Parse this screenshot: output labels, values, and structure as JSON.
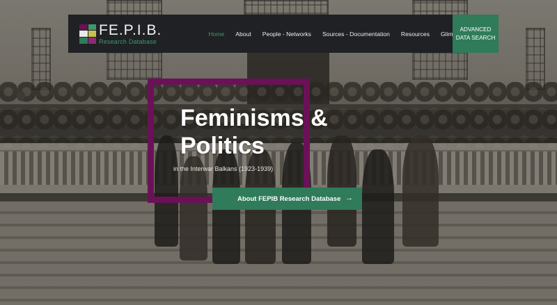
{
  "brand": {
    "title": "FE.P.I.B.",
    "subtitle": "Research Database",
    "logo_colors": [
      "#6b1157",
      "#3c9a6e",
      "#c9c24a",
      "#e8e8e8",
      "#2f7b5a",
      "#8d2a76"
    ]
  },
  "nav": {
    "items": [
      {
        "label": "Home",
        "active": true
      },
      {
        "label": "About",
        "active": false
      },
      {
        "label": "People - Networks",
        "active": false
      },
      {
        "label": "Sources - Documentation",
        "active": false
      },
      {
        "label": "Resources",
        "active": false
      },
      {
        "label": "Glimpse of the Past",
        "active": false
      }
    ],
    "advanced_line1": "ADVANCED",
    "advanced_line2": "DATA SEARCH"
  },
  "hero": {
    "title_line1": "Feminisms &",
    "title_line2": "Politics",
    "subtitle": "in the Interwar Balkans (1923-1939)",
    "cta_label": "About FEPIB Research Database",
    "cta_icon": "arrow-right-icon"
  },
  "colors": {
    "accent_green": "#2f7b5a",
    "frame_purple": "#6b1157",
    "nav_bg": "#1f2124",
    "active_link": "#3c9a6e"
  }
}
